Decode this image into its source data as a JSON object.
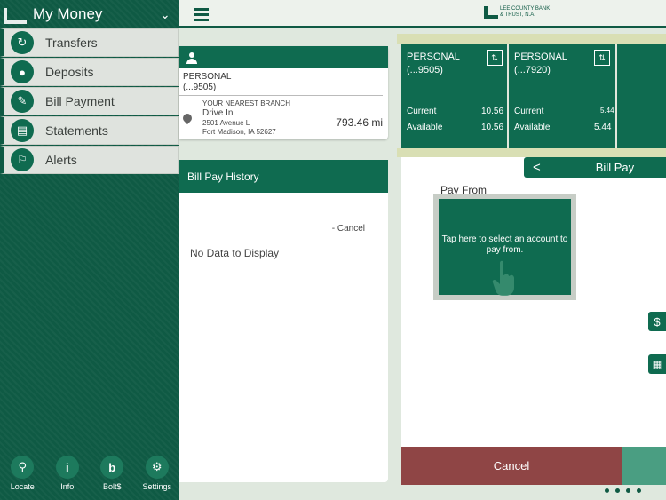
{
  "sidebar": {
    "title": "My Money",
    "items": [
      {
        "label": "Transfers",
        "icon": "transfer-icon"
      },
      {
        "label": "Deposits",
        "icon": "piggy-bank-icon"
      },
      {
        "label": "Bill Payment",
        "icon": "bill-icon"
      },
      {
        "label": "Statements",
        "icon": "book-icon"
      },
      {
        "label": "Alerts",
        "icon": "bell-icon"
      }
    ],
    "footer": [
      {
        "label": "Locate",
        "icon": "search-icon"
      },
      {
        "label": "Info",
        "icon": "info-icon"
      },
      {
        "label": "Bolt$",
        "icon": "bolt-icon"
      },
      {
        "label": "Settings",
        "icon": "gear-icon"
      }
    ]
  },
  "brand": {
    "line1": "LEE COUNTY BANK",
    "line2": "& TRUST, N.A."
  },
  "branch": {
    "account_type": "PERSONAL",
    "account_number": "(...9505)",
    "heading": "YOUR NEAREST BRANCH",
    "name": "Drive In",
    "address1": "2501 Avenue L",
    "address2": "Fort Madison, IA 52627",
    "distance": "793.46 mi"
  },
  "history": {
    "title": "Bill Pay History",
    "cancel": "- Cancel",
    "empty": "No Data to Display"
  },
  "accounts": [
    {
      "type": "PERSONAL",
      "number": "(...9505)",
      "current_label": "Current",
      "current": "10.56",
      "available_label": "Available",
      "available": "10.56"
    },
    {
      "type": "PERSONAL",
      "number": "(...7920)",
      "current_label": "Current",
      "current": "5.44",
      "available_label": "Available",
      "available": "5.44"
    }
  ],
  "billpay": {
    "back": "<",
    "title": "Bill Pay",
    "pay_from_label": "Pay From",
    "pay_from_hint": "Tap here to select an account to pay from.",
    "cancel": "Cancel"
  },
  "colors": {
    "primary": "#0f6b50",
    "sidebar": "#0f5a44",
    "cancel": "#8f4545"
  }
}
